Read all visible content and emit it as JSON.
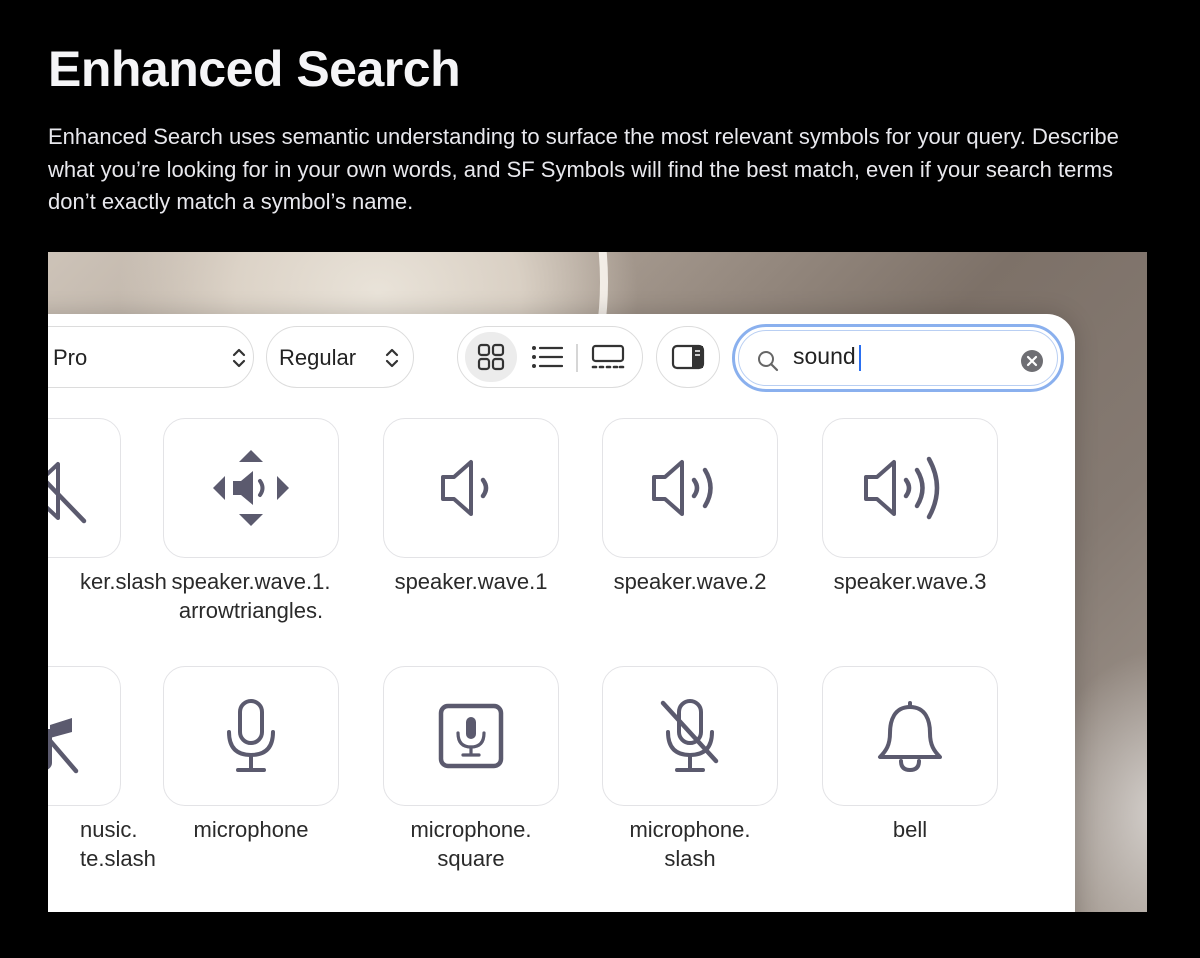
{
  "page": {
    "title": "Enhanced Search",
    "description": "Enhanced Search uses semantic understanding to surface the most relevant symbols for your query. Describe what you’re looking for in your own words, and SF Symbols will find the best match, even if your search terms don’t exactly match a symbol’s name."
  },
  "toolbar": {
    "font_selector": "Pro",
    "weight_selector": "Regular",
    "view_modes": [
      {
        "name": "grid-view",
        "icon": "grid-2x2-icon",
        "active": true
      },
      {
        "name": "list-view",
        "icon": "list-bullet-icon",
        "active": false
      },
      {
        "name": "gallery-view",
        "icon": "gallery-icon",
        "active": false
      }
    ],
    "inspector_toggle_icon": "sidebar-right-icon",
    "search": {
      "value": "sound",
      "icon": "magnifyingglass-icon",
      "clear_icon": "xmark-circle-fill-icon"
    }
  },
  "symbols_row1": [
    {
      "lines": [
        "ker.slash"
      ],
      "icon": "speaker-slash-icon"
    },
    {
      "lines": [
        "speaker.wave.1.",
        "arrowtriangles."
      ],
      "icon": "speaker-arrowtriangles-icon"
    },
    {
      "lines": [
        "speaker.wave.1"
      ],
      "icon": "speaker-wave-1-icon"
    },
    {
      "lines": [
        "speaker.wave.2"
      ],
      "icon": "speaker-wave-2-icon"
    },
    {
      "lines": [
        "speaker.wave.3"
      ],
      "icon": "speaker-wave-3-icon"
    }
  ],
  "symbols_row2": [
    {
      "lines": [
        "nusic.",
        "te.slash"
      ],
      "icon": "music-note-slash-icon"
    },
    {
      "lines": [
        "microphone"
      ],
      "icon": "microphone-icon"
    },
    {
      "lines": [
        "microphone.",
        "square"
      ],
      "icon": "microphone-square-icon"
    },
    {
      "lines": [
        "microphone.",
        "slash"
      ],
      "icon": "microphone-slash-icon"
    },
    {
      "lines": [
        "bell"
      ],
      "icon": "bell-icon"
    }
  ],
  "colors": {
    "background": "#000000",
    "symbol": "#5b5a6e",
    "search_focus": "#8ab0ee",
    "window": "#ffffff"
  }
}
